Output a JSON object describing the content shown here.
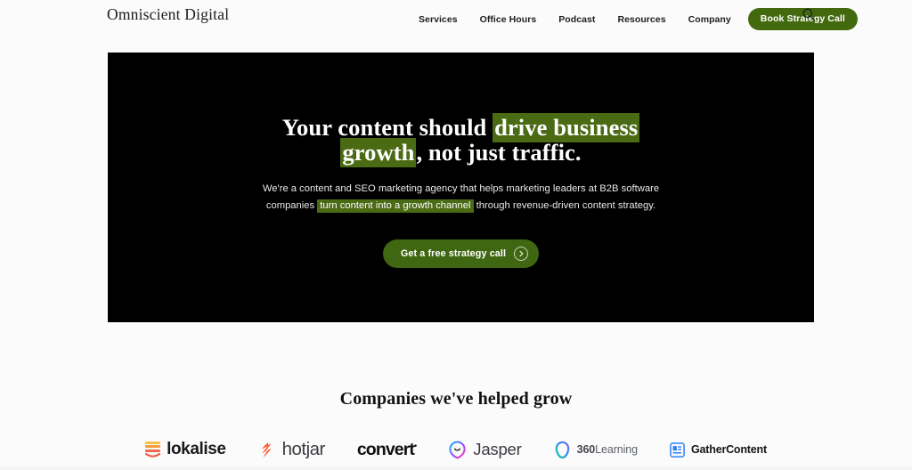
{
  "header": {
    "brand": "Omniscient Digital",
    "nav": [
      {
        "label": "Services"
      },
      {
        "label": "Office Hours"
      },
      {
        "label": "Podcast"
      },
      {
        "label": "Resources"
      },
      {
        "label": "Company"
      }
    ],
    "cta_label": "Book Strategy Call",
    "search_icon": "search-icon",
    "cta_color": "#43690f"
  },
  "hero": {
    "background_color": "#000000",
    "highlight_color": "#4a6a14",
    "title": {
      "part1": "Your content should ",
      "highlight": "drive business growth",
      "part2": ", not just traffic."
    },
    "subtitle": {
      "part1": "We're a content and SEO marketing agency that helps marketing leaders at B2B software companies ",
      "highlight": "turn content into a growth channel",
      "part2": " through revenue-driven content strategy."
    },
    "cta_label": "Get a free strategy call",
    "cta_icon": "chevron-right-icon",
    "cta_color": "#3f6610"
  },
  "clients": {
    "heading": "Companies we've helped grow",
    "logos": [
      {
        "name": "lokalise",
        "label": "lokalise",
        "icon": "lokalise-bars-icon"
      },
      {
        "name": "hotjar",
        "label": "hotjar",
        "icon": "hotjar-flame-icon",
        "color": "#fa5b35"
      },
      {
        "name": "convert",
        "label": "convert",
        "icon": "convert-slash-icon"
      },
      {
        "name": "jasper",
        "label": "Jasper",
        "icon": "jasper-smiley-icon"
      },
      {
        "name": "360learning",
        "label_bold": "360",
        "label_rest": "Learning",
        "icon": "360learning-ring-icon"
      },
      {
        "name": "gathercontent",
        "label": "GatherContent",
        "icon": "gathercontent-square-icon",
        "color": "#2d7ff9"
      }
    ]
  }
}
